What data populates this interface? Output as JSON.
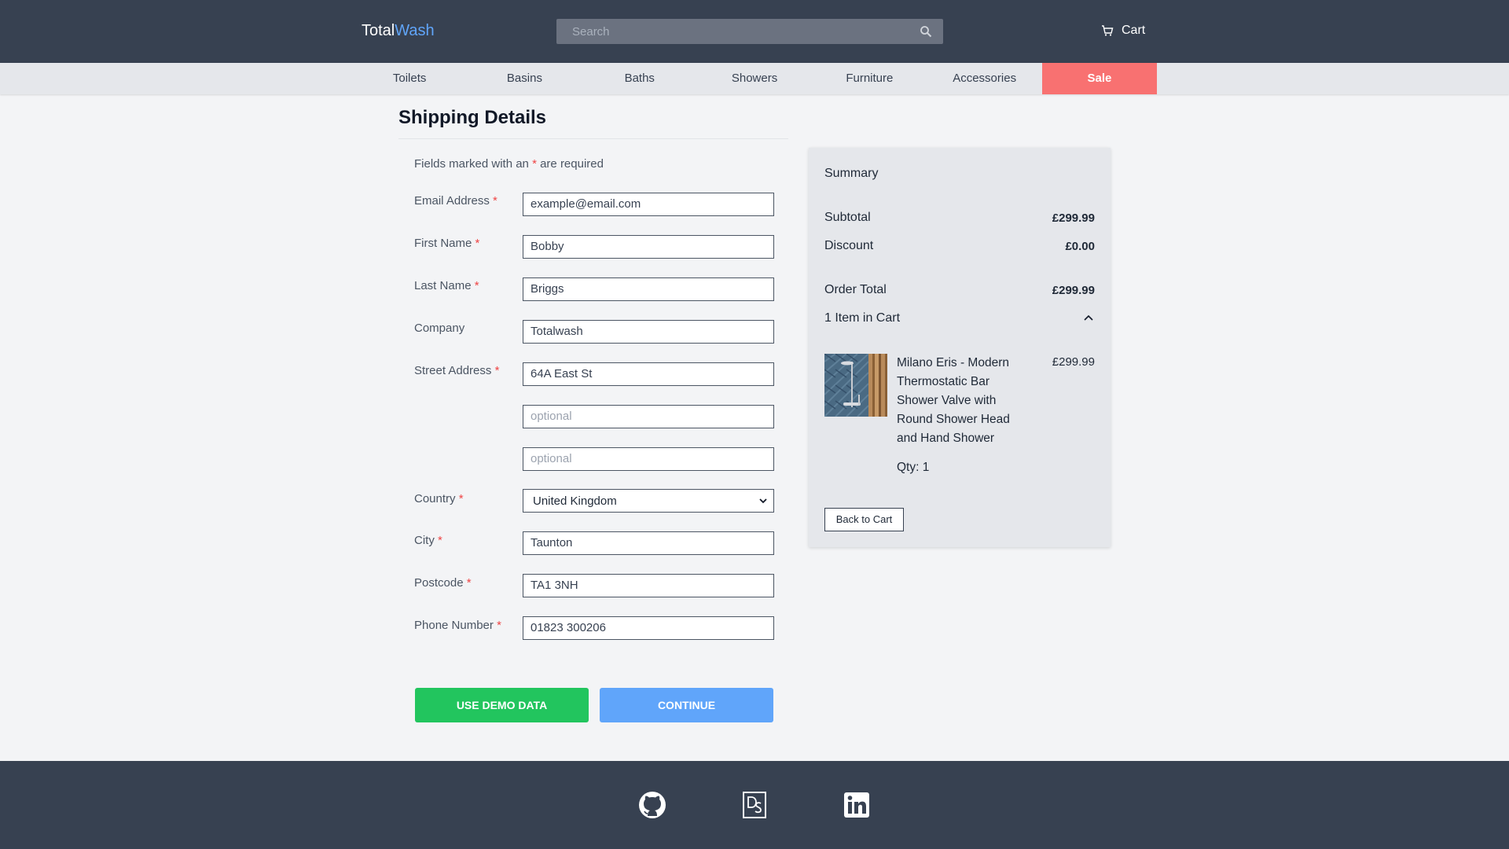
{
  "header": {
    "logo_part1": "Total",
    "logo_part2": "Wash",
    "search_placeholder": "Search",
    "cart_label": "Cart"
  },
  "nav": {
    "items": [
      "Toilets",
      "Basins",
      "Baths",
      "Showers",
      "Furniture",
      "Accessories",
      "Sale"
    ]
  },
  "form": {
    "title": "Shipping Details",
    "required_note_before": "Fields marked with an",
    "required_star": "*",
    "required_note_after": "are required",
    "fields": {
      "email": {
        "label": "Email Address",
        "value": "example@email.com"
      },
      "first_name": {
        "label": "First Name",
        "value": "Bobby"
      },
      "last_name": {
        "label": "Last Name",
        "value": "Briggs"
      },
      "company": {
        "label": "Company",
        "value": "Totalwash"
      },
      "street": {
        "label": "Street Address",
        "value": "64A East St",
        "line2_placeholder": "optional",
        "line3_placeholder": "optional"
      },
      "country": {
        "label": "Country",
        "value": "United Kingdom"
      },
      "city": {
        "label": "City",
        "value": "Taunton"
      },
      "postcode": {
        "label": "Postcode",
        "value": "TA1 3NH"
      },
      "phone": {
        "label": "Phone Number",
        "value": "01823 300206"
      }
    },
    "demo_button": "USE DEMO DATA",
    "continue_button": "CONTINUE"
  },
  "summary": {
    "heading": "Summary",
    "subtotal_label": "Subtotal",
    "subtotal_value": "£299.99",
    "discount_label": "Discount",
    "discount_value": "£0.00",
    "order_total_label": "Order Total",
    "order_total_value": "£299.99",
    "items_in_cart": "1 Item in Cart",
    "item": {
      "name": "Milano Eris - Modern Thermostatic Bar Shower Valve with Round Shower Head and Hand Shower",
      "price": "£299.99",
      "qty": "Qty: 1"
    },
    "back_button": "Back to Cart"
  },
  "footer": {
    "icons": [
      "github-icon",
      "ds-logo-icon",
      "linkedin-icon"
    ]
  },
  "colors": {
    "header_bg": "#374151",
    "accent_blue": "#60a5fa",
    "sale_red": "#f87171",
    "demo_green": "#22c55e",
    "required_red": "#ef4444"
  }
}
